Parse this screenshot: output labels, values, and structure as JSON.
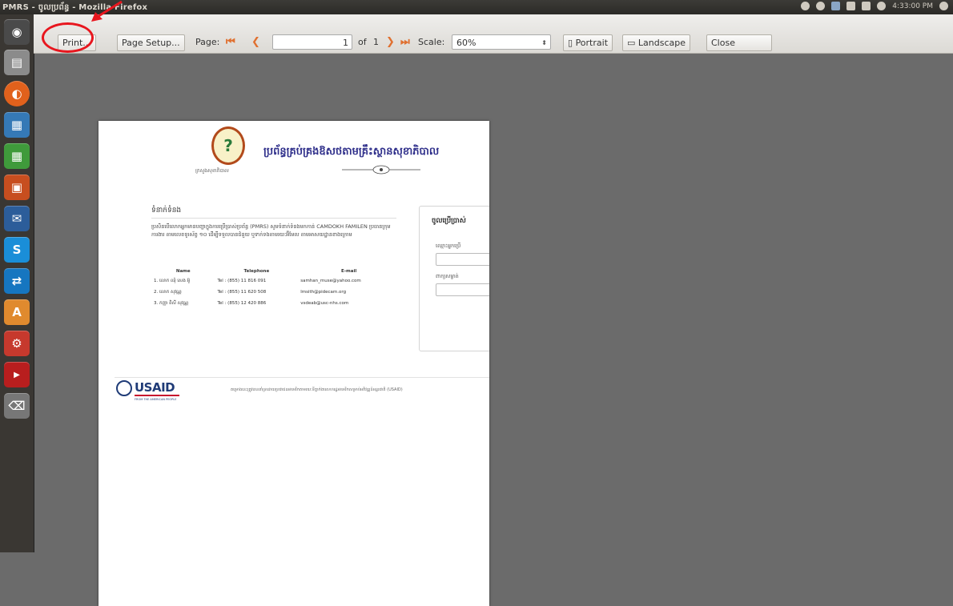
{
  "window": {
    "title": "PMRS - ចូលប្រព័ន្ធ - Mozilla Firefox"
  },
  "tray": {
    "clock": "4:33:00 PM",
    "icons": [
      "chrome-icon",
      "wifi-icon",
      "keyboard-icon",
      "mail-icon",
      "battery-icon",
      "volume-icon",
      "settings-gear-icon"
    ]
  },
  "launcher": {
    "items": [
      "ubuntu-dash-icon",
      "files-icon",
      "firefox-icon",
      "writer-icon",
      "calc-icon",
      "impress-icon",
      "thunderbird-icon",
      "skype-icon",
      "teamviewer-icon",
      "software-center-icon",
      "system-settings-icon",
      "youtube-icon",
      "trash-icon"
    ]
  },
  "toolbar": {
    "print_label": "Print...",
    "page_setup_label": "Page Setup...",
    "page_label": "Page:",
    "page_value": "1",
    "of_label": "of",
    "total_pages": "1",
    "scale_label": "Scale:",
    "scale_value": "60%",
    "portrait_label": "Portrait",
    "landscape_label": "Landscape",
    "close_label": "Close"
  },
  "page": {
    "logo_caption": "ក្រសួងសុខាភិបាល",
    "title": "ប្រព័ន្ធគ្រប់គ្រងឱសថតាមគ្រឹះស្ថានសុខាភិបាល",
    "contact_heading": "ទំនាក់ទំនង",
    "intro": "ប្រសិនបើលោកអ្នកមានបញ្ហាក្នុងការប្រើប្រាស់ប្រព័ន្ធ (PMRS) សូមទំនាក់ទំនងមកកាន់ CAMDOKH FAMILEN ប្រធានក្រុមការងារ តាមលេខទូរស័ព្ទ ១០ ដើម្បីទទួលបានជំនួយ ឬទាក់ទងតាមរយៈអ៊ីមែល តាមអាសយដ្ឋានខាងក្រោម",
    "table_headers": [
      "Name",
      "Telephone",
      "E-mail"
    ],
    "contacts": [
      [
        "1. លោក ឈុំ សេង អ៊ូ",
        "Tel : (855) 11 816 091",
        "samhan_muse@yahoo.com"
      ],
      [
        "2. លោក សុវណ្ណ",
        "Tel : (855) 11 620 508",
        "lmsith@pidecam.org"
      ],
      [
        "3. កញ្ញា ពិសី សុវណ្ណ",
        "Tel : (855) 12 420 886",
        "vsdeab@usc-nhs.com"
      ]
    ],
    "login_title": "ចូលប្រើប្រាស់",
    "login_fields": [
      "ឈ្មោះអ្នកប្រើ",
      "ពាក្យសម្ងាត់"
    ],
    "footer_text": "គម្រោងនេះត្រូវបានគាំទ្រដោយប្រជាជនអាមេរិកតាមរយៈទីភ្នាក់ងារសហរដ្ឋអាមេរិកសម្រាប់អភិវឌ្ឍន៍អន្តរជាតិ (USAID)",
    "usaid_logo_text": "USAID",
    "usaid_tagline": "FROM THE AMERICAN PEOPLE"
  },
  "colors": {
    "annotation": "#e8161e",
    "title_blue": "#2e2e8a",
    "usaid_blue": "#1f3b77"
  }
}
